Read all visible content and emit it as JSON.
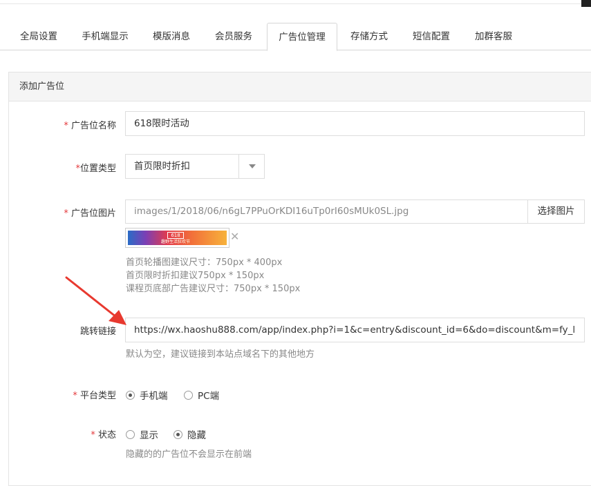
{
  "tabs": [
    {
      "label": "全局设置"
    },
    {
      "label": "手机端显示"
    },
    {
      "label": "模版消息"
    },
    {
      "label": "会员服务"
    },
    {
      "label": "广告位管理",
      "active": true
    },
    {
      "label": "存储方式"
    },
    {
      "label": "短信配置"
    },
    {
      "label": "加群客服"
    }
  ],
  "panel": {
    "title": "添加广告位"
  },
  "form": {
    "required_mark": "*",
    "name": {
      "label": "广告位名称",
      "value": "618限时活动"
    },
    "position_type": {
      "label": "位置类型",
      "value": "首页限时折扣"
    },
    "image": {
      "label": "广告位图片",
      "path": "images/1/2018/06/n6gL7PPuOrKDI16uTp0rI60sMUk0SL.jpg",
      "button": "选择图片",
      "thumb_badge": "618",
      "thumb_caption": "趣野生活狂欢节",
      "help": [
        "首页轮播图建议尺寸：750px * 400px",
        "首页限时折扣建议750px * 150px",
        "课程页底部广告建议尺寸：750px * 150px"
      ]
    },
    "link": {
      "label": "跳转链接",
      "value": "https://wx.haoshu888.com/app/index.php?i=1&c=entry&discount_id=6&do=discount&m=fy_l",
      "help": "默认为空，建议链接到本站点域名下的其他地方"
    },
    "platform": {
      "label": "平台类型",
      "options": [
        {
          "label": "手机端",
          "checked": true
        },
        {
          "label": "PC端",
          "checked": false
        }
      ]
    },
    "status": {
      "label": "状态",
      "options": [
        {
          "label": "显示",
          "checked": false
        },
        {
          "label": "隐藏",
          "checked": true
        }
      ],
      "help": "隐藏的的广告位不会显示在前端"
    }
  },
  "colors": {
    "required": "#e4393c",
    "arrow": "#e8392f"
  }
}
